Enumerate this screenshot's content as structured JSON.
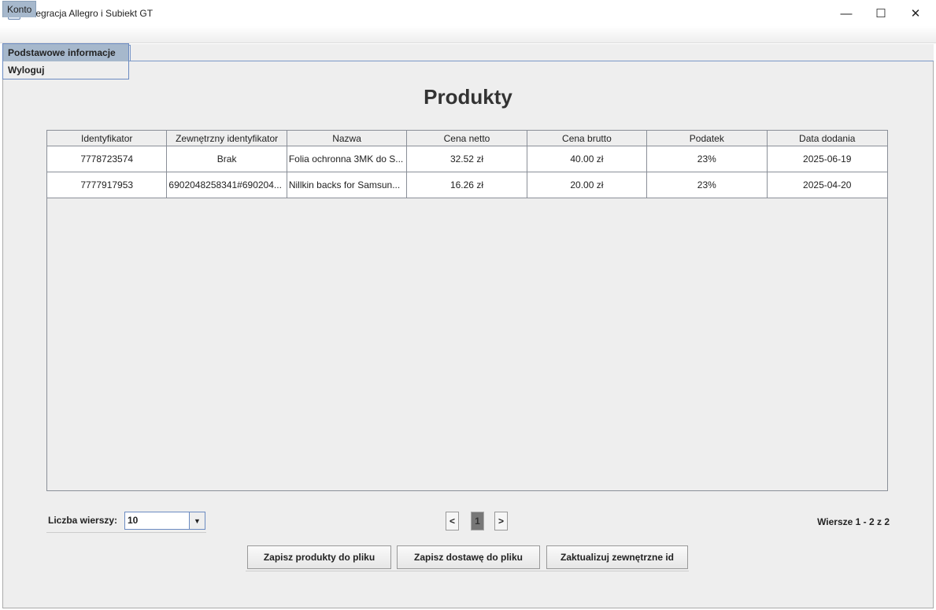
{
  "window": {
    "title": "Integracja Allegro i Subiekt GT",
    "minimize": "—",
    "maximize": "☐",
    "close": "✕"
  },
  "menu": {
    "konto": "Konto",
    "items": [
      "Podstawowe informacje",
      "Wyloguj"
    ]
  },
  "page_title": "Produkty",
  "table": {
    "headers": [
      "Identyfikator",
      "Zewnętrzny identyfikator",
      "Nazwa",
      "Cena netto",
      "Cena brutto",
      "Podatek",
      "Data dodania"
    ],
    "rows": [
      [
        "7778723574",
        "Brak",
        "Folia ochronna 3MK do S...",
        "32.52 zł",
        "40.00 zł",
        "23%",
        "2025-06-19"
      ],
      [
        "7777917953",
        "6902048258341#690204...",
        "Nillkin backs for Samsun...",
        "16.26 zł",
        "20.00 zł",
        "23%",
        "2025-04-20"
      ]
    ]
  },
  "pagination": {
    "rows_label": "Liczba wierszy:",
    "rows_value": "10",
    "prev": "<",
    "page": "1",
    "next": ">",
    "info": "Wiersze 1 - 2 z 2"
  },
  "buttons": {
    "save_products": "Zapisz produkty do pliku",
    "save_delivery": "Zapisz dostawę do pliku",
    "update_ids": "Zaktualizuj zewnętrzne id"
  }
}
